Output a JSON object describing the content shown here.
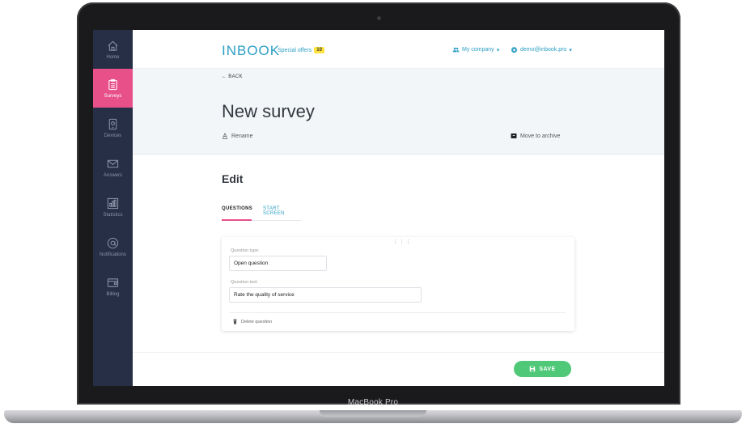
{
  "device": {
    "model_label": "MacBook Pro"
  },
  "sidebar": {
    "items": [
      {
        "label": "Home",
        "icon": "home-icon"
      },
      {
        "label": "Surveys",
        "icon": "clipboard-icon",
        "active": true
      },
      {
        "label": "Devices",
        "icon": "tablet-icon"
      },
      {
        "label": "Answers",
        "icon": "envelope-icon"
      },
      {
        "label": "Statistics",
        "icon": "chart-icon"
      },
      {
        "label": "Notifications",
        "icon": "at-icon"
      },
      {
        "label": "Billing",
        "icon": "wallet-icon"
      }
    ]
  },
  "header": {
    "logo": "INBOOK",
    "offers_label": "Special offers",
    "offers_count": "10",
    "company_label": "My company",
    "user_label": "demo@inbook.pro"
  },
  "page": {
    "back_label": "← BACK",
    "title": "New survey",
    "rename_label": "Rename",
    "archive_label": "Move to archive"
  },
  "editor": {
    "title": "Edit",
    "tabs": [
      {
        "label": "QUESTIONS",
        "active": true
      },
      {
        "label": "START SCREEN",
        "active": false
      }
    ],
    "question": {
      "drag_handle": "⋮⋮⋮",
      "type_label": "Question type:",
      "type_value": "Open question",
      "text_label": "Question text:",
      "text_value": "Rate the quality of service",
      "delete_label": "Delete question"
    }
  },
  "footer": {
    "save_label": "SAVE"
  },
  "colors": {
    "sidebar_bg": "#262f46",
    "active_pink": "#e8508a",
    "brand_blue": "#2d9fc4",
    "save_green": "#4fc878",
    "badge_yellow": "#ffe23c"
  }
}
